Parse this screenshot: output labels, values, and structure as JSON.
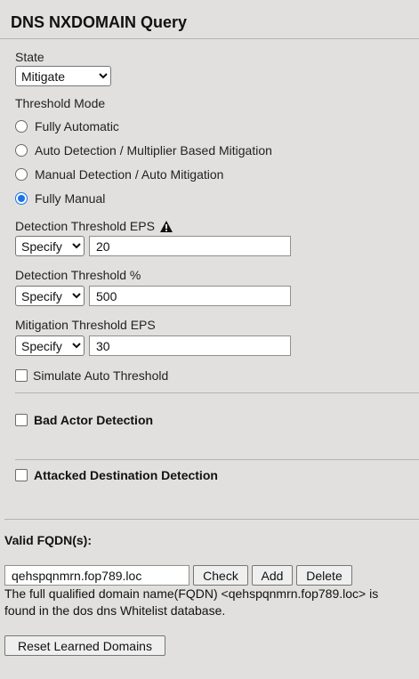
{
  "panel": {
    "title": "DNS NXDOMAIN Query"
  },
  "state": {
    "label": "State",
    "value": "Mitigate",
    "options": [
      "Mitigate"
    ]
  },
  "threshold_mode": {
    "label": "Threshold Mode",
    "options": [
      {
        "label": "Fully Automatic",
        "checked": false
      },
      {
        "label": "Auto Detection / Multiplier Based Mitigation",
        "checked": false
      },
      {
        "label": "Manual Detection / Auto Mitigation",
        "checked": false
      },
      {
        "label": "Fully Manual",
        "checked": true
      }
    ]
  },
  "detection_eps": {
    "label": "Detection Threshold EPS",
    "mode": "Specify",
    "value": "20",
    "warning_icon": "warning-triangle-icon"
  },
  "detection_pct": {
    "label": "Detection Threshold %",
    "mode": "Specify",
    "value": "500"
  },
  "mitigation_eps": {
    "label": "Mitigation Threshold EPS",
    "mode": "Specify",
    "value": "30"
  },
  "simulate": {
    "label": "Simulate Auto Threshold",
    "checked": false
  },
  "bad_actor": {
    "label": "Bad Actor Detection",
    "checked": false
  },
  "attacked_dest": {
    "label": "Attacked Destination Detection",
    "checked": false
  },
  "fqdn": {
    "label": "Valid FQDN(s):",
    "value": "qehspqnmrn.fop789.loc",
    "check_label": "Check",
    "add_label": "Add",
    "delete_label": "Delete",
    "message_line1": "The full qualified domain name(FQDN) <qehspqnmrn.fop789.loc> is",
    "message_line2": "found in the dos dns Whitelist database."
  },
  "reset_label": "Reset Learned Domains"
}
